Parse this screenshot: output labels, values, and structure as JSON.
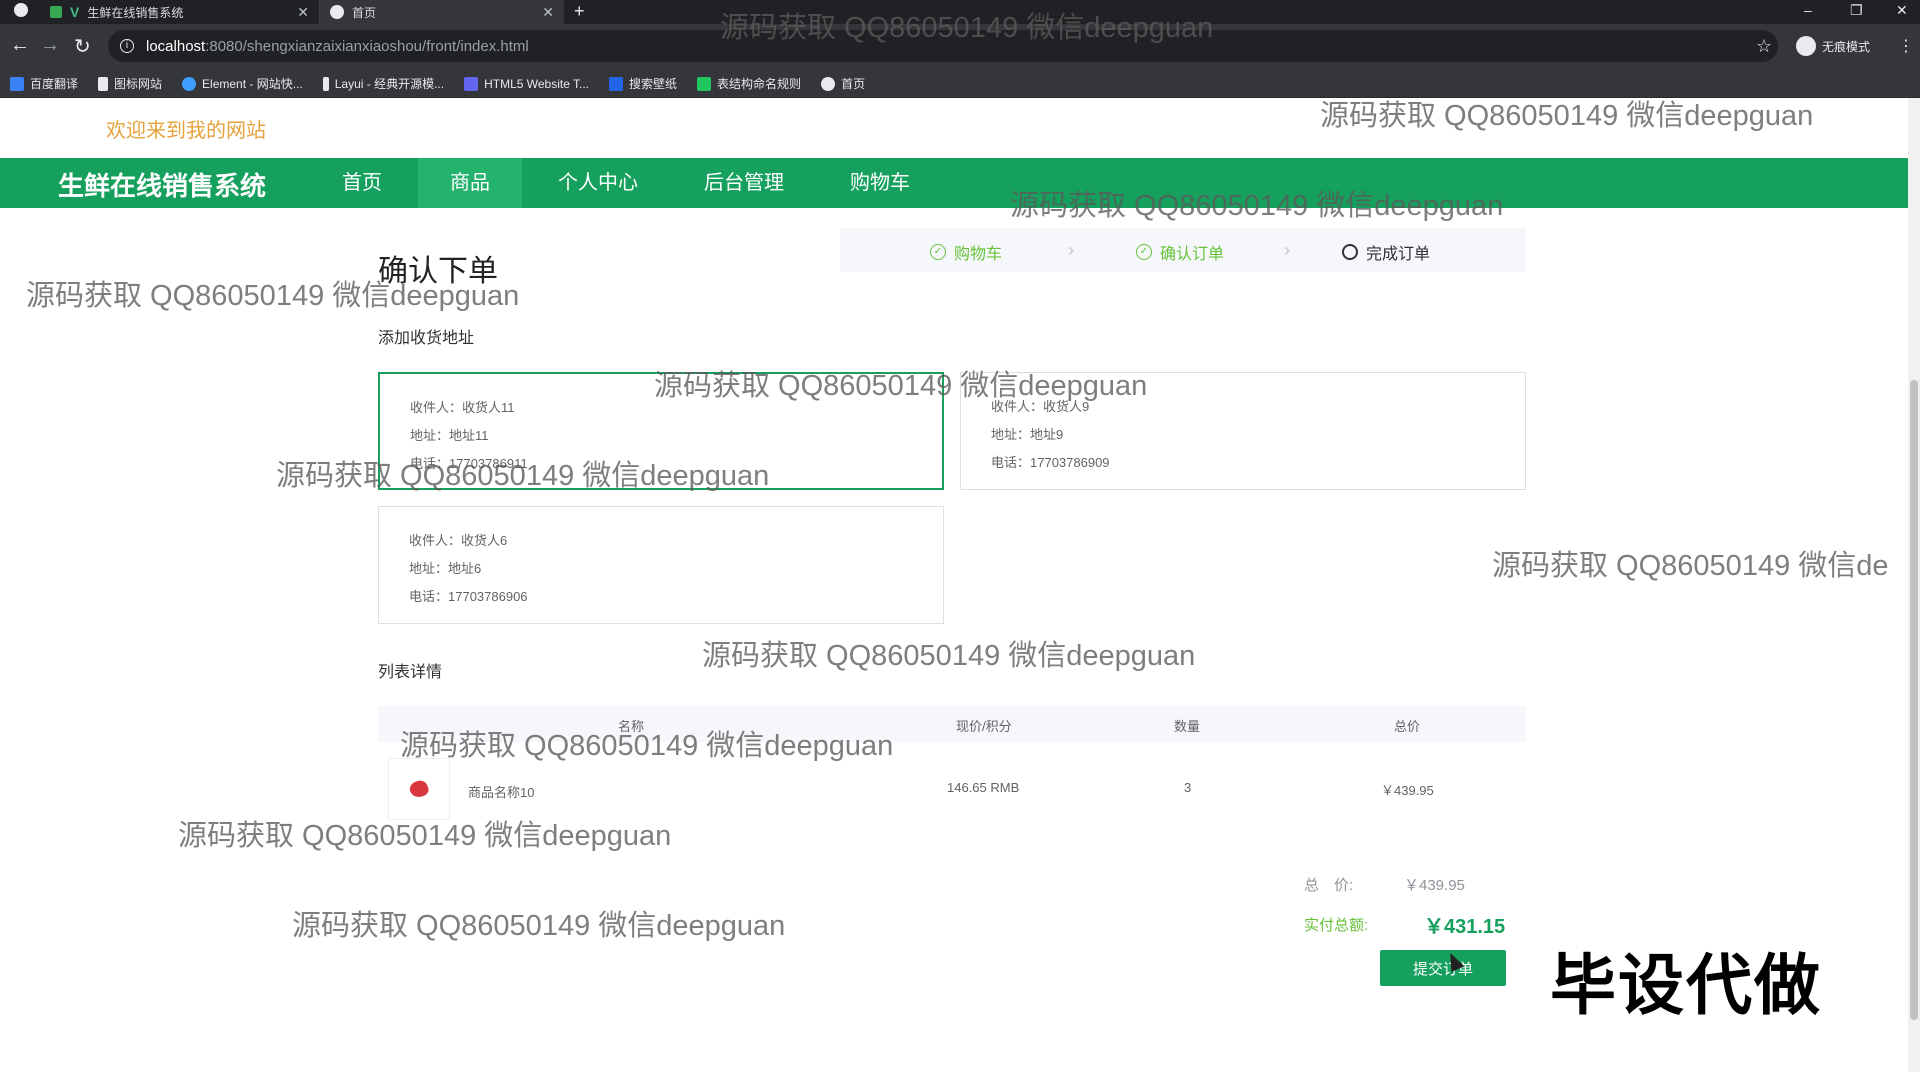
{
  "browser": {
    "tabs": [
      {
        "title": "生鲜在线销售系统"
      },
      {
        "title": "首页"
      }
    ],
    "url_host": "localhost",
    "url_path": ":8080/shengxianzaixianxiaoshou/front/index.html",
    "profile_label": "无痕模式",
    "bookmarks": [
      {
        "label": "百度翻译",
        "color": "#3b82f6"
      },
      {
        "label": "图标网站",
        "color": "#e8eaed"
      },
      {
        "label": "Element - 网站快...",
        "color": "#409eff"
      },
      {
        "label": "Layui - 经典开源模...",
        "color": "#e8eaed"
      },
      {
        "label": "HTML5 Website T...",
        "color": "#6366f1"
      },
      {
        "label": "搜索壁纸",
        "color": "#2563eb"
      },
      {
        "label": "表结构命名规则",
        "color": "#22c55e"
      },
      {
        "label": "首页",
        "color": "#e8eaed"
      }
    ]
  },
  "site": {
    "welcome": "欢迎来到我的网站",
    "brand": "生鲜在线销售系统",
    "nav": [
      {
        "label": "首页",
        "active": false
      },
      {
        "label": "商品",
        "active": true
      },
      {
        "label": "个人中心",
        "active": false
      },
      {
        "label": "后台管理",
        "active": false
      },
      {
        "label": "购物车",
        "active": false
      }
    ]
  },
  "order": {
    "title": "确认下单",
    "steps": [
      {
        "label": "购物车",
        "state": "done"
      },
      {
        "label": "确认订单",
        "state": "done"
      },
      {
        "label": "完成订单",
        "state": "current"
      }
    ],
    "address_section_label": "添加收货地址",
    "addresses": [
      {
        "receiver": "收件人：收货人11",
        "address": "地址：地址11",
        "phone": "电话：17703786911",
        "selected": true
      },
      {
        "receiver": "收件人：收货人9",
        "address": "地址：地址9",
        "phone": "电话：17703786909",
        "selected": false
      },
      {
        "receiver": "收件人：收货人6",
        "address": "地址：地址6",
        "phone": "电话：17703786906",
        "selected": false
      }
    ],
    "list_section_label": "列表详情",
    "table": {
      "headers": [
        "名称",
        "现价/积分",
        "数量",
        "总价"
      ],
      "rows": [
        {
          "name": "商品名称10",
          "price": "146.65 RMB",
          "qty": "3",
          "total": "￥439.95"
        }
      ]
    },
    "total_label": "总　价:",
    "total_value": "￥439.95",
    "paid_label": "实付总额:",
    "paid_value": "￥431.15",
    "submit_label": "提交订单"
  },
  "overlay": {
    "watermark_text": "源码获取 QQ86050149 微信deepguan",
    "watermark_text_cut": "源码获取 QQ86050149 微信de",
    "stamp": "毕设代做"
  },
  "colors": {
    "brand_green": "#16a05d",
    "active_nav": "#23b36d",
    "welcome_orange": "#e6a23c",
    "step_done": "#67c23a"
  }
}
